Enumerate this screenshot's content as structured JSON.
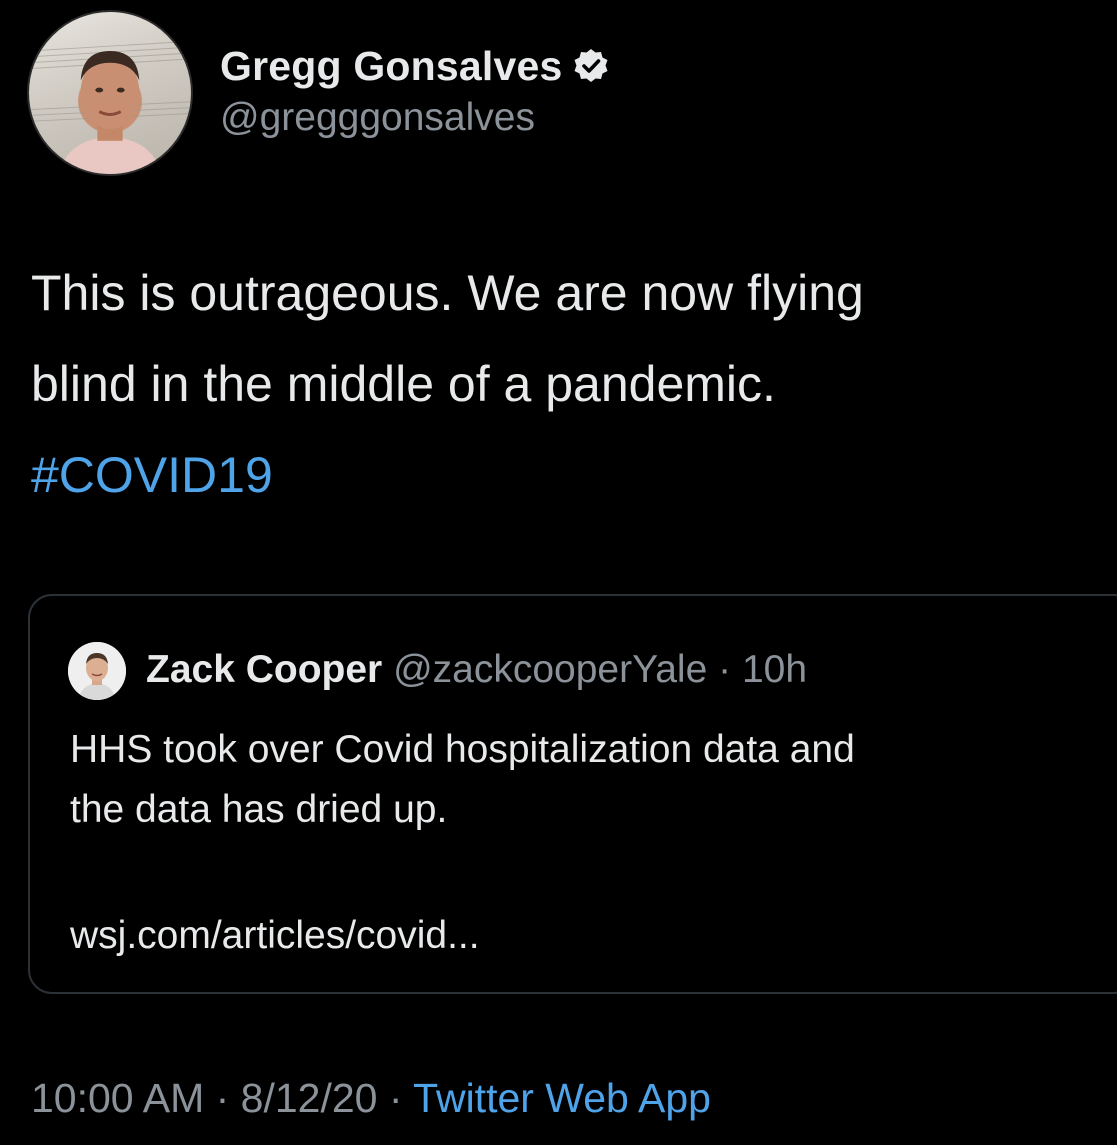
{
  "author": {
    "display_name": "Gregg Gonsalves",
    "handle": "@gregggonsalves",
    "verified_icon": "verified-badge-icon"
  },
  "tweet": {
    "text_lines": [
      "This is outrageous. We are now flying",
      "blind in the middle of a pandemic."
    ],
    "hashtag": "#COVID19"
  },
  "quoted_tweet": {
    "display_name": "Zack Cooper",
    "handle": "@zackcooperYale",
    "separator": " · ",
    "time_ago": "10h",
    "text_lines": [
      "HHS took over Covid hospitalization data and",
      "the data has dried up."
    ],
    "link": "wsj.com/articles/covid..."
  },
  "meta": {
    "time": "10:00 AM",
    "separator": " · ",
    "date": "8/12/20",
    "source": "Twitter Web App"
  },
  "colors": {
    "background": "#000000",
    "text": "#e7e9ea",
    "muted": "#8b9299",
    "link": "#4fa3e8",
    "border": "#2c3136"
  }
}
